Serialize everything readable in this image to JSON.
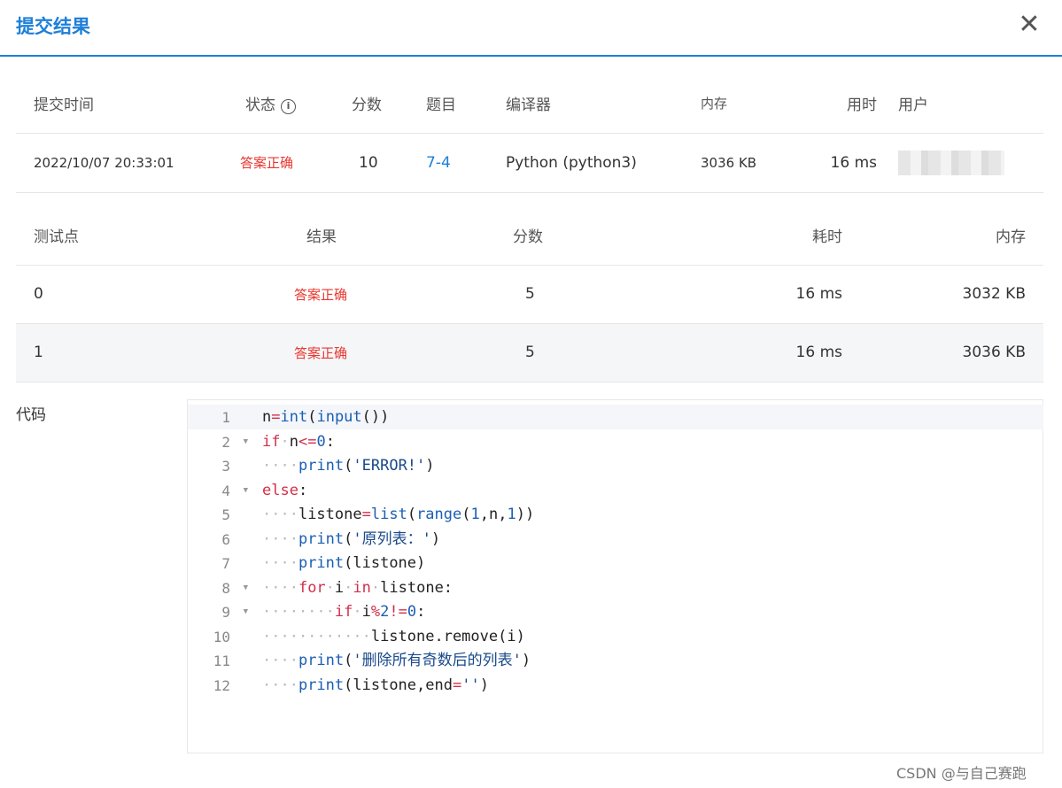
{
  "dialog": {
    "title": "提交结果",
    "close_label": "✕"
  },
  "summary": {
    "headers": {
      "time": "提交时间",
      "status": "状态",
      "score": "分数",
      "problem": "题目",
      "compiler": "编译器",
      "memory": "内存",
      "duration": "用时",
      "user": "用户"
    },
    "row": {
      "time": "2022/10/07 20:33:01",
      "status": "答案正确",
      "score": "10",
      "problem": "7-4",
      "compiler": "Python (python3)",
      "memory": "3036 KB",
      "duration": "16 ms"
    }
  },
  "testcases": {
    "headers": {
      "case": "测试点",
      "result": "结果",
      "score": "分数",
      "time": "耗时",
      "memory": "内存"
    },
    "rows": [
      {
        "case": "0",
        "result": "答案正确",
        "score": "5",
        "time": "16 ms",
        "memory": "3032 KB"
      },
      {
        "case": "1",
        "result": "答案正确",
        "score": "5",
        "time": "16 ms",
        "memory": "3036 KB"
      }
    ]
  },
  "code": {
    "label": "代码",
    "line_numbers": [
      "1",
      "2",
      "3",
      "4",
      "5",
      "6",
      "7",
      "8",
      "9",
      "10",
      "11",
      "12"
    ],
    "lines": [
      "n=int(input())",
      "if n<=0:",
      "    print('ERROR!')",
      "else:",
      "    listone=list(range(1,n,1))",
      "    print('原列表：')",
      "    print(listone)",
      "    for i in listone:",
      "        if i%2!=0:",
      "            listone.remove(i)",
      "    print('删除所有奇数后的列表')",
      "    print(listone,end='')"
    ]
  },
  "watermark": "CSDN @与自己赛跑"
}
